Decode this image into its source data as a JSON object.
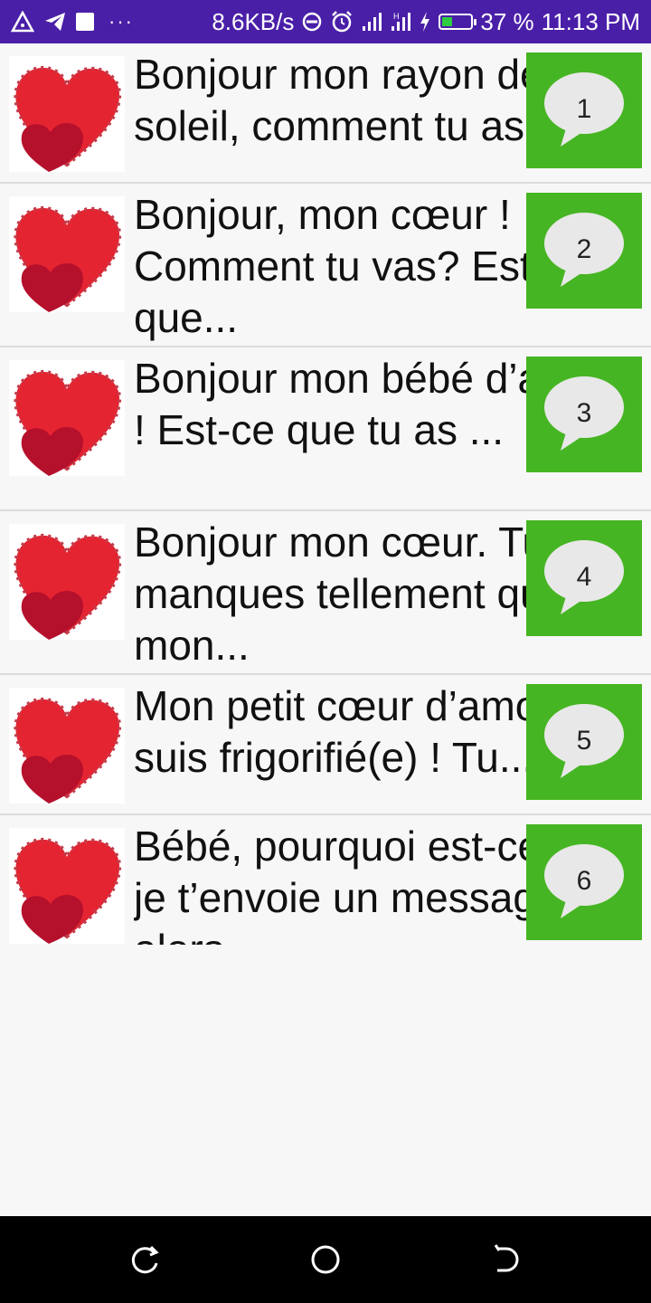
{
  "status_bar": {
    "speed": "8.6KB/s",
    "battery": "37 %",
    "battery_level": 0.37,
    "time": "11:13 PM",
    "dots": "···",
    "icons": [
      "warning-triangle-icon",
      "telegram-icon",
      "square-icon",
      "more-icon",
      "dnd-icon",
      "alarm-icon",
      "signal-icon",
      "signal-h-icon",
      "charging-icon",
      "battery-icon"
    ]
  },
  "messages": [
    {
      "text": "Bonjour mon rayon de soleil, comment tu as...",
      "number": "1"
    },
    {
      "text": "Bonjour, mon cœur ! Comment tu vas? Est-ce que...",
      "number": "2"
    },
    {
      "text": "Bonjour mon bébé d’amour ! Est-ce que tu as ...",
      "number": "3"
    },
    {
      "text": "Bonjour mon cœur. Tu me manques tellement que mon...",
      "number": "4"
    },
    {
      "text": "Mon petit cœur d’amour, je suis frigorifié(e) ! Tu...",
      "number": "5"
    },
    {
      "text": "Bébé, pourquoi est-ce que je t’envoie un message alors",
      "number": "6"
    }
  ],
  "nav_bar": {
    "icons": [
      "recent-apps-icon",
      "home-icon",
      "back-icon"
    ]
  },
  "colors": {
    "status_bar": "#4a1fa8",
    "badge_green": "#46b523",
    "heart_red": "#e52431",
    "heart_dark": "#b5102c"
  }
}
